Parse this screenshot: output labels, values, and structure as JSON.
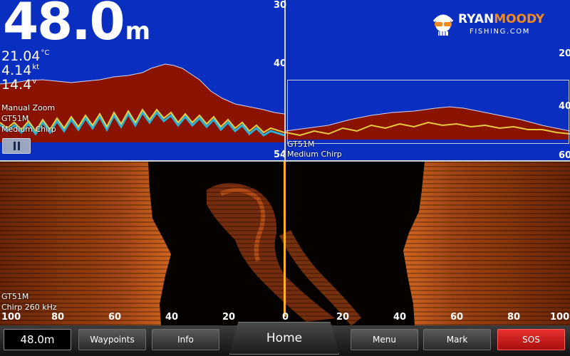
{
  "header": {
    "depth": "48.0",
    "depth_unit": "m",
    "water_temp": "21.04",
    "water_temp_unit": "°C",
    "speed": "4.14",
    "speed_unit": "kt",
    "voltage": "14.4",
    "voltage_unit": "v"
  },
  "zoom_panel": {
    "mode": "Manual Zoom",
    "transducer": "GT51M",
    "frequency": "Medium Chirp",
    "scale": [
      "40",
      "54"
    ]
  },
  "full_panel": {
    "transducer": "GT51M",
    "frequency": "Medium Chirp",
    "scale_top": "30",
    "scale": [
      "20",
      "40",
      "60"
    ]
  },
  "logo": {
    "line1_a": "RYAN",
    "line1_b": "MOODY",
    "line2": "FISHING.COM",
    "orange": "#f28a1e"
  },
  "sidevu": {
    "transducer": "GT51M",
    "frequency": "Chirp 260 kHz",
    "range_left": [
      "100",
      "80",
      "60",
      "40",
      "20"
    ],
    "range_center": "0",
    "range_right": [
      "20",
      "40",
      "60",
      "80",
      "100"
    ]
  },
  "bottom_bar": {
    "depth_button": "48.0m",
    "waypoints": "Waypoints",
    "info": "Info",
    "home": "Home",
    "menu": "Menu",
    "mark": "Mark",
    "sos": "SOS"
  },
  "colors": {
    "sonar_background": "#0a2fc0",
    "bottom_return": "#8a1200",
    "sidevu_return": "#c85a14",
    "center_line": "#ffb020",
    "sos": "#d21a1a"
  }
}
